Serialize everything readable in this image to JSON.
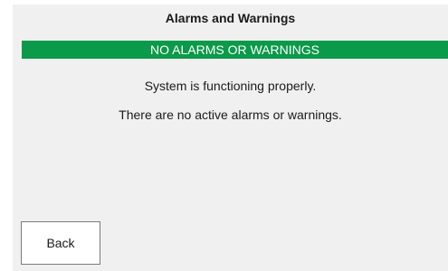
{
  "header": {
    "title": "Alarms and Warnings"
  },
  "status": {
    "text": "NO ALARMS OR WARNINGS",
    "color": "#0a9a4a"
  },
  "messages": [
    "System is functioning properly.",
    "There are no active alarms or warnings."
  ],
  "footer": {
    "back_label": "Back"
  }
}
